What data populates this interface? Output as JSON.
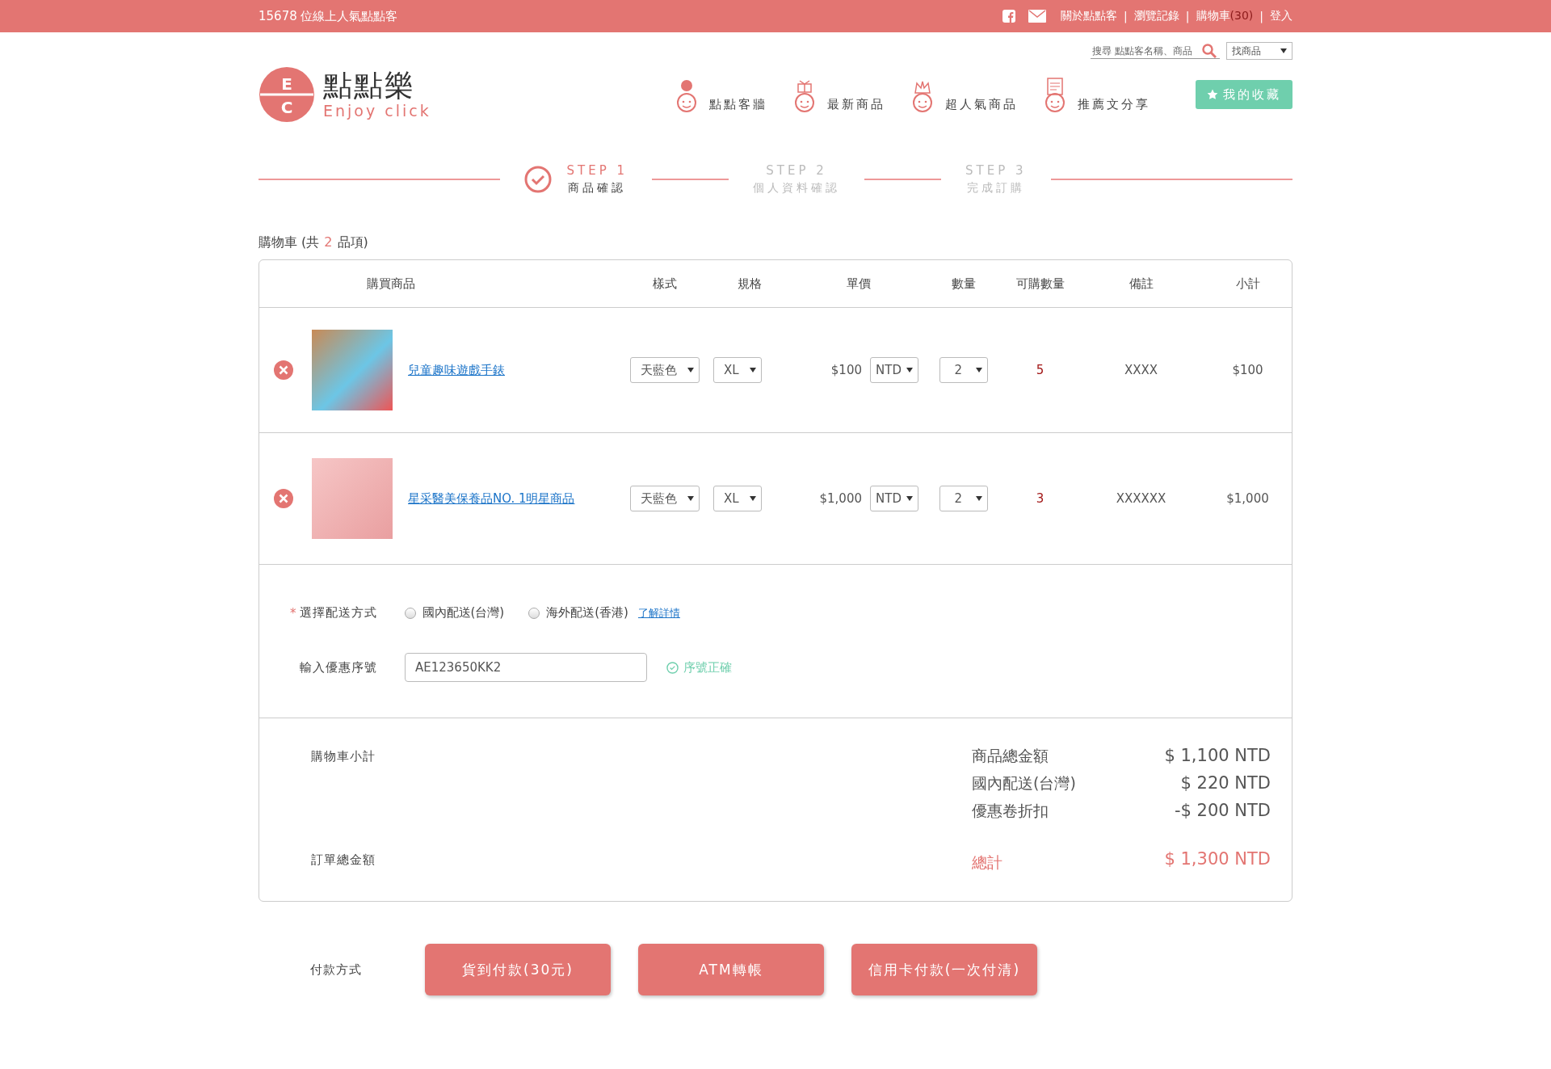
{
  "top_bar": {
    "online_count": "15678 位線上人氣點點客",
    "links": [
      {
        "label": "關於點點客"
      },
      {
        "separator": "|",
        "label": "瀏覽記錄"
      },
      {
        "separator": "|",
        "label": "購物車",
        "count": "(30)"
      },
      {
        "separator": "|",
        "label": "登入"
      }
    ]
  },
  "header": {
    "logo": {
      "letters": [
        "E",
        "C"
      ],
      "name": "點點樂",
      "tagline": "Enjoy click"
    },
    "search": {
      "placeholder": "搜尋 點點客名稱、商品"
    },
    "category": {
      "value": "找商品"
    },
    "nav": [
      {
        "label": "點點客牆"
      },
      {
        "label": "最新商品"
      },
      {
        "label": "超人氣商品"
      },
      {
        "label": "推薦文分享"
      }
    ],
    "favorites": "我的收藏"
  },
  "steps": [
    {
      "label": "STEP 1",
      "caption": "商品確認",
      "selected": true
    },
    {
      "label": "STEP 2",
      "caption": "個人資料確認",
      "selected": false
    },
    {
      "label": "STEP 3",
      "caption": "完成訂購",
      "selected": false
    }
  ],
  "cart": {
    "title": "購物車 (共",
    "count": "2",
    "title_end": "品項)",
    "columns": [
      "購買商品",
      "樣式",
      "規格",
      "單價",
      "數量",
      "可購數量",
      "備註",
      "小計"
    ],
    "rows": [
      {
        "name": "兒童趣味遊戲手錶",
        "style": "天藍色",
        "size": "XL",
        "price": "$100",
        "currency": "NTD",
        "qty": "2",
        "available": "5",
        "note": "XXXX",
        "subtotal": "$100"
      },
      {
        "name": "星采醫美保養品NO. 1明星商品",
        "style": "天藍色",
        "size": "XL",
        "price": "$1,000",
        "currency": "NTD",
        "qty": "2",
        "available": "3",
        "note": "XXXXXX",
        "subtotal": "$1,000"
      }
    ]
  },
  "shipping": {
    "required_mark": "*",
    "label": "選擇配送方式",
    "options": [
      {
        "label": "國內配送(台灣)",
        "selected": false
      },
      {
        "label": "海外配送(香港)",
        "selected": false
      }
    ],
    "link": "了解詳情"
  },
  "coupon": {
    "label": "輸入優惠序號",
    "value": "AE123650KK2",
    "status": "序號正確"
  },
  "summary": {
    "subtotal_label": "購物車小計",
    "lines": [
      {
        "label": "商品總金額",
        "value": "$ 1,100 NTD"
      },
      {
        "label": "國內配送(台灣)",
        "value": "$ 220 NTD"
      },
      {
        "label": "優惠卷折扣",
        "value": "-$ 200 NTD"
      }
    ],
    "total_label": "訂單總金額",
    "total": {
      "label": "總計",
      "value": "$ 1,300 NTD"
    }
  },
  "payment": {
    "label": "付款方式",
    "buttons": [
      "貨到付款(30元)",
      "ATM轉帳",
      "信用卡付款(一次付清)"
    ]
  }
}
